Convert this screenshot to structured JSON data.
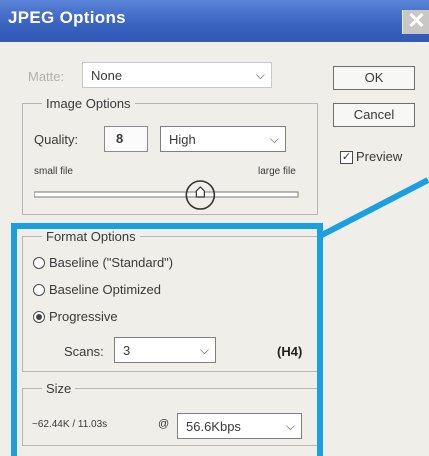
{
  "window": {
    "title": "JPEG Options",
    "close_glyph": "✕"
  },
  "matte": {
    "label": "Matte:",
    "value": "None"
  },
  "image_options": {
    "legend": "Image Options",
    "quality_label": "Quality:",
    "quality_value": "8",
    "quality_preset": "High",
    "small_file_label": "small file",
    "large_file_label": "large file",
    "slider_fraction": 0.63
  },
  "buttons": {
    "ok": "OK",
    "cancel": "Cancel"
  },
  "preview": {
    "label": "Preview",
    "checked": true,
    "check_glyph": "✓"
  },
  "format_options": {
    "legend": "Format Options",
    "radios": [
      {
        "label": "Baseline (\"Standard\")",
        "selected": false
      },
      {
        "label": "Baseline Optimized",
        "selected": false
      },
      {
        "label": "Progressive",
        "selected": true
      }
    ],
    "scans_label": "Scans:",
    "scans_value": "3",
    "annotation": "(H4)"
  },
  "size": {
    "legend": "Size",
    "estimate": "~62.44K / 11.03s",
    "at_label": "@",
    "speed": "56.6Kbps"
  },
  "icons": {
    "chevron": "chevron-down-icon",
    "slider": "slider-thumb-icon"
  },
  "colors": {
    "titlebar": "#3a64c0",
    "frame_accent": "#1aa0e0",
    "panel_bg": "#efeee8"
  }
}
